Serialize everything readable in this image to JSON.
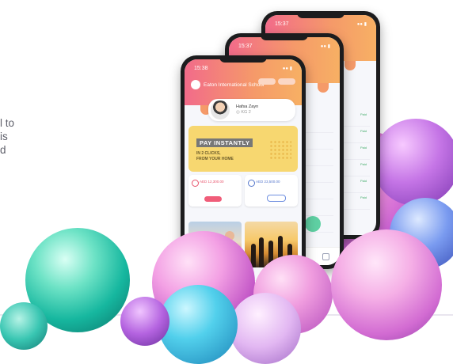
{
  "side_text": {
    "line1": "l to",
    "line2": "is",
    "line3": "d"
  },
  "phones": {
    "front": {
      "time": "15:38",
      "school": "Eaton International School",
      "student_name": "Hafsa Zayn",
      "student_meta": "◎ KG 2",
      "promo_title": "PAY INSTANTLY",
      "promo_sub1": "IN 2 CLICKS,",
      "promo_sub2": "FROM YOUR HOME",
      "due_amount": "AED 12,300.00",
      "paid_amount": "AED 23,500.00"
    },
    "middle": {
      "time": "15:37"
    },
    "back": {
      "time": "15:37"
    }
  },
  "colors": {
    "header_start": "#f26b8a",
    "header_end": "#f7b064",
    "promo": "#f7d770",
    "accent_pink": "#f05d79",
    "paid_green": "#3caa65"
  }
}
